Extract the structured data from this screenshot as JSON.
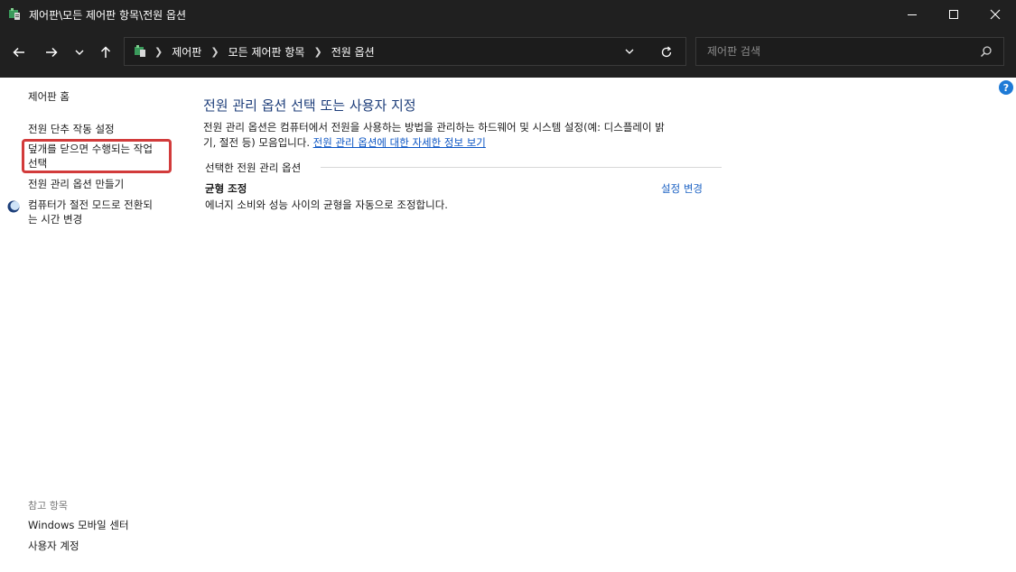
{
  "window": {
    "title": "제어판\\모든 제어판 항목\\전원 옵션"
  },
  "nav": {
    "breadcrumbs": [
      "제어판",
      "모든 제어판 항목",
      "전원 옵션"
    ],
    "search_placeholder": "제어판 검색"
  },
  "sidebar": {
    "home": "제어판 홈",
    "links": [
      "전원 단추 작동 설정",
      "덮개를 닫으면 수행되는 작업 선택",
      "전원 관리 옵션 만들기",
      "컴퓨터가 절전 모드로 전환되는 시간 변경"
    ],
    "lid_line1": "덮개를 닫으면 수행되는 작업",
    "lid_line2": "선택",
    "sleep_line1": "컴퓨터가 절전 모드로 전환되",
    "sleep_line2": "는 시간 변경",
    "see_also_header": "참고 항목",
    "see_also": [
      "Windows 모바일 센터",
      "사용자 계정"
    ]
  },
  "main": {
    "title": "전원 관리 옵션 선택 또는 사용자 지정",
    "description_line1": "전원 관리 옵션은 컴퓨터에서 전원을 사용하는 방법을 관리하는 하드웨어 및 시스템 설정(예: 디스플레이 밝",
    "description_line2": "기, 절전 등) 모음입니다.",
    "description_link": "전원 관리 옵션에 대한 자세한 정보 보기",
    "section_header": "선택한 전원 관리 옵션",
    "plan": {
      "name": "균형 조정",
      "description": "에너지 소비와 성능 사이의 균형을 자동으로 조정합니다.",
      "settings_link": "설정 변경"
    }
  },
  "colors": {
    "highlight": "#d23b3b",
    "title_blue": "#1e3e7a",
    "link_blue": "#0b55c4"
  }
}
